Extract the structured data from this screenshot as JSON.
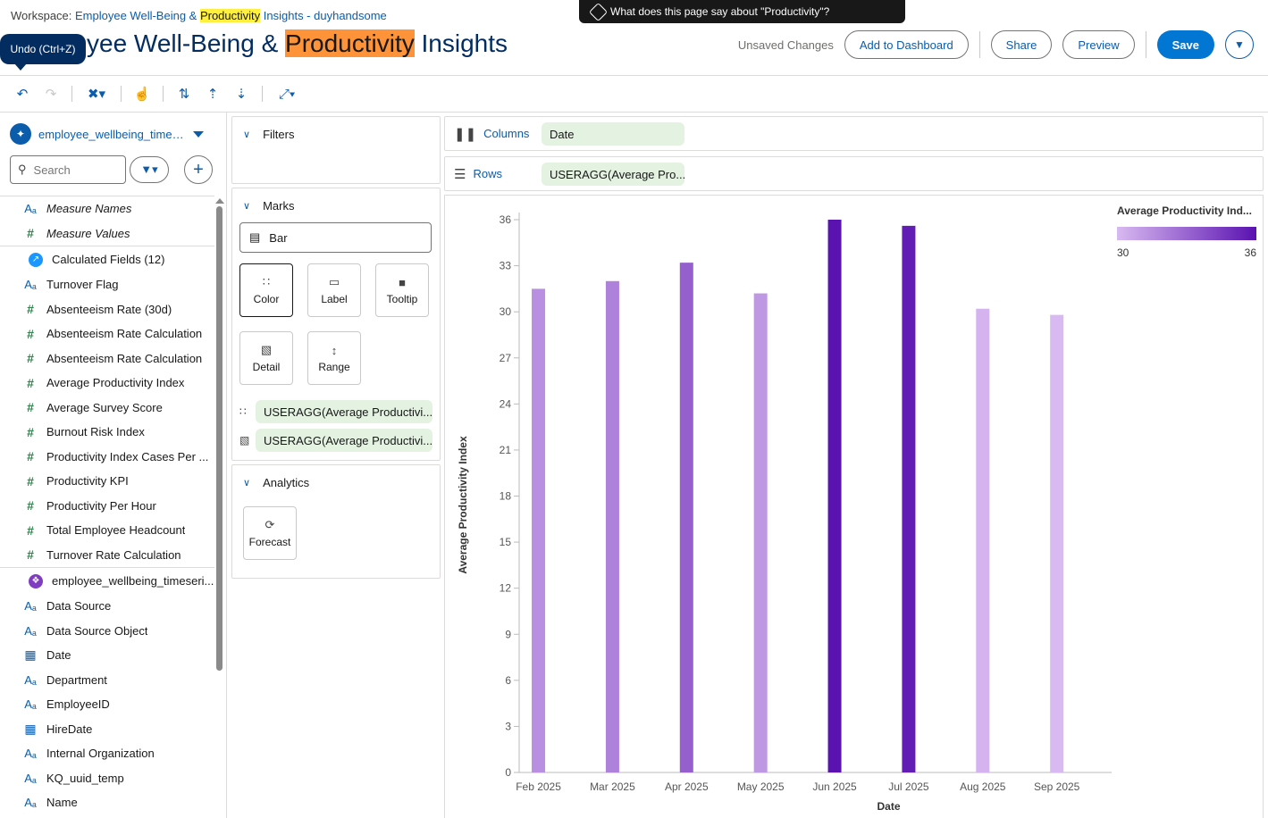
{
  "header": {
    "workspace_prefix": "Workspace: ",
    "workspace_name_pre": "Employee Well-Being & ",
    "workspace_name_hl": "Productivity",
    "workspace_name_post": " Insights - duyhandsome",
    "title_pre": "yee Well-Being & ",
    "title_hl": "Productivity",
    "title_post": " Insights",
    "unsaved": "Unsaved Changes",
    "add_to_dashboard": "Add to Dashboard",
    "share": "Share",
    "preview": "Preview",
    "save": "Save"
  },
  "tooltip": "Undo (Ctrl+Z)",
  "ai_banner": "What does this page say about \"Productivity\"?",
  "toolbar": {
    "icons": [
      "undo-icon",
      "redo-icon",
      "clear-icon",
      "touch-icon",
      "swap-icon",
      "sort-asc-icon",
      "sort-desc-icon",
      "fit-icon"
    ]
  },
  "left_panel": {
    "datasource": "employee_wellbeing_times...",
    "search_placeholder": "Search",
    "fields_top": [
      {
        "icon": "text",
        "label": "Measure Names",
        "italic": true
      },
      {
        "icon": "measure",
        "label": "Measure Values",
        "italic": true
      }
    ],
    "calc_group": "Calculated Fields (12)",
    "calc_fields": [
      {
        "icon": "text",
        "label": "Turnover Flag"
      },
      {
        "icon": "measure",
        "label": "Absenteeism Rate (30d)"
      },
      {
        "icon": "measure",
        "label": "Absenteeism Rate Calculation"
      },
      {
        "icon": "measure",
        "label": "Absenteeism Rate Calculation"
      },
      {
        "icon": "measure",
        "label": "Average Productivity Index"
      },
      {
        "icon": "measure",
        "label": "Average Survey Score"
      },
      {
        "icon": "measure",
        "label": "Burnout Risk Index"
      },
      {
        "icon": "measure",
        "label": "Productivity Index Cases Per ..."
      },
      {
        "icon": "measure",
        "label": "Productivity KPI"
      },
      {
        "icon": "measure",
        "label": "Productivity Per Hour"
      },
      {
        "icon": "measure",
        "label": "Total Employee Headcount"
      },
      {
        "icon": "measure",
        "label": "Turnover Rate Calculation"
      }
    ],
    "table_group": "employee_wellbeing_timeseri...",
    "table_fields": [
      {
        "icon": "text",
        "label": "Data Source"
      },
      {
        "icon": "text",
        "label": "Data Source Object"
      },
      {
        "icon": "date",
        "label": "Date"
      },
      {
        "icon": "text",
        "label": "Department"
      },
      {
        "icon": "text",
        "label": "EmployeeID"
      },
      {
        "icon": "date",
        "label": "HireDate"
      },
      {
        "icon": "text",
        "label": "Internal Organization"
      },
      {
        "icon": "text",
        "label": "KQ_uuid_temp"
      },
      {
        "icon": "text",
        "label": "Name"
      }
    ]
  },
  "cards": {
    "filters": "Filters",
    "marks": "Marks",
    "mark_type": "Bar",
    "mark_buttons": [
      "Color",
      "Label",
      "Tooltip",
      "Detail",
      "Range"
    ],
    "pill_color": "USERAGG(Average Productivi...",
    "pill_detail": "USERAGG(Average Productivi...",
    "analytics": "Analytics",
    "forecast": "Forecast"
  },
  "shelves": {
    "columns_label": "Columns",
    "columns_pill": "Date",
    "rows_label": "Rows",
    "rows_pill": "USERAGG(Average Pro..."
  },
  "chart_data": {
    "type": "bar",
    "categories": [
      "Feb 2025",
      "Mar 2025",
      "Apr 2025",
      "May 2025",
      "Jun 2025",
      "Jul 2025",
      "Aug 2025",
      "Sep 2025"
    ],
    "values": [
      31.5,
      32.0,
      33.2,
      31.2,
      36.0,
      35.6,
      30.2,
      29.8
    ],
    "xlabel": "Date",
    "ylabel": "Average Productivity Index",
    "yticks": [
      0,
      3,
      6,
      9,
      12,
      15,
      18,
      21,
      24,
      27,
      30,
      33,
      36
    ],
    "ylim": [
      0,
      36
    ],
    "legend_title": "Average Productivity Ind...",
    "legend_min": "30",
    "legend_max": "36",
    "color_low": "#d8b9f1",
    "color_high": "#5a12b0"
  }
}
